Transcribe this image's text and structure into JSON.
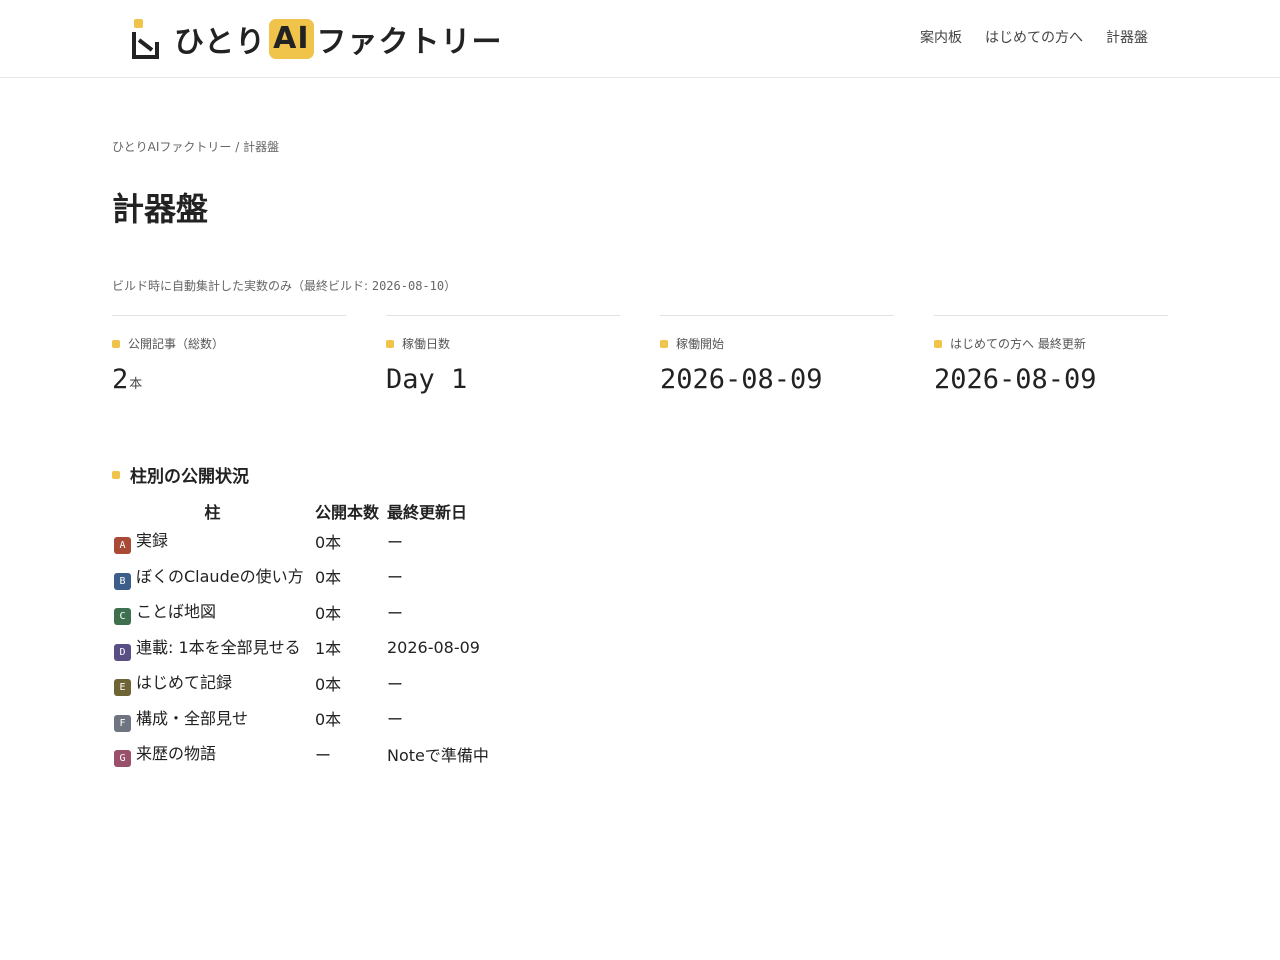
{
  "header": {
    "logo": {
      "part1": "ひとり",
      "ai": "AI",
      "part2": "ファクトリー",
      "accent": "#f0c34a"
    },
    "nav": [
      {
        "label": "案内板"
      },
      {
        "label": "はじめての方へ"
      },
      {
        "label": "計器盤"
      }
    ]
  },
  "breadcrumb": {
    "home": "ひとりAIファクトリー",
    "sep": " / ",
    "current": "計器盤"
  },
  "page_title": "計器盤",
  "note": {
    "text": "ビルド時に自動集計した実数のみ（最終ビルド: ",
    "date": "2026-08-10",
    "close": "）"
  },
  "stats": [
    {
      "label": "公開記事（総数）",
      "value": "2",
      "unit": "本"
    },
    {
      "label": "稼働日数",
      "value": "Day 1",
      "unit": ""
    },
    {
      "label": "稼働開始",
      "value": "2026-08-09",
      "unit": ""
    },
    {
      "label": "はじめての方へ 最終更新",
      "value": "2026-08-09",
      "unit": ""
    }
  ],
  "section": {
    "title": "柱別の公開状況",
    "headers": [
      "柱",
      "公開本数",
      "最終更新日"
    ],
    "rows": [
      {
        "code": "A",
        "color": "#a84a35",
        "name": "実録",
        "count": "0本",
        "updated": "ー"
      },
      {
        "code": "B",
        "color": "#3b5f8a",
        "name": "ぼくのClaudeの使い方",
        "count": "0本",
        "updated": "ー"
      },
      {
        "code": "C",
        "color": "#3e7050",
        "name": "ことば地図",
        "count": "0本",
        "updated": "ー"
      },
      {
        "code": "D",
        "color": "#5a4f85",
        "name": "連載: 1本を全部見せる",
        "count": "1本",
        "updated": "2026-08-09"
      },
      {
        "code": "E",
        "color": "#6e6435",
        "name": "はじめて記録",
        "count": "0本",
        "updated": "ー"
      },
      {
        "code": "F",
        "color": "#6e7480",
        "name": "構成・全部見せ",
        "count": "0本",
        "updated": "ー"
      },
      {
        "code": "G",
        "color": "#9a4f6a",
        "name": "来歴の物語",
        "count": "ー",
        "updated": "Noteで準備中"
      }
    ]
  }
}
